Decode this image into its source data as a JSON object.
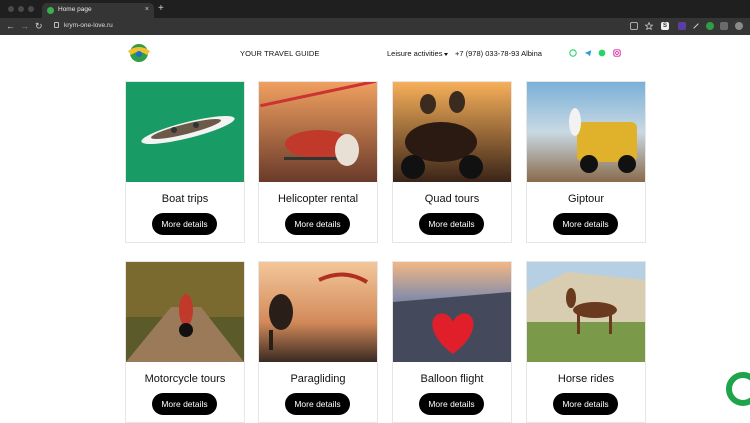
{
  "browser": {
    "tab_title": "Home page",
    "tab_close": "×",
    "new_tab": "+",
    "url": "krym-one-love.ru",
    "back": "←",
    "forward": "→",
    "reload": "↻"
  },
  "header": {
    "tagline": "YOUR TRAVEL GUIDE",
    "leisure_menu": "Leisure activities",
    "phone": "+7 (978) 033-78-93 Albina"
  },
  "cards": [
    {
      "title": "Boat trips",
      "button": "More details"
    },
    {
      "title": "Helicopter rental",
      "button": "More details"
    },
    {
      "title": "Quad tours",
      "button": "More details"
    },
    {
      "title": "Giptour",
      "button": "More details"
    },
    {
      "title": "Motorcycle tours",
      "button": "More details"
    },
    {
      "title": "Paragliding",
      "button": "More details"
    },
    {
      "title": "Balloon flight",
      "button": "More details"
    },
    {
      "title": "Horse rides",
      "button": "More details"
    }
  ],
  "colors": {
    "accent": "#1fa34b",
    "button": "#000000"
  }
}
